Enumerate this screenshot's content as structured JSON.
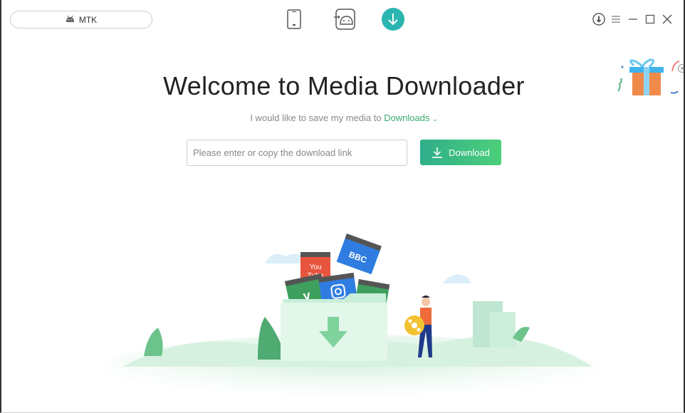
{
  "device": {
    "name": "MTK",
    "icon": "android-icon"
  },
  "nav": [
    {
      "name": "phone-icon"
    },
    {
      "name": "android-transfer-icon"
    },
    {
      "name": "download-icon",
      "active": true
    }
  ],
  "window_controls": [
    "download-circle-icon",
    "menu-icon",
    "minimize-icon",
    "maximize-icon",
    "close-icon"
  ],
  "main": {
    "title": "Welcome to Media Downloader",
    "save_prefix": "I would like to save my media to",
    "save_location": "Downloads",
    "input_placeholder": "Please enter or copy the download link",
    "input_value": "",
    "download_label": "Download"
  },
  "illustration": {
    "labels": [
      "You",
      "Tube",
      "BBC",
      "Vimeo",
      "Instagram"
    ]
  },
  "colors": {
    "accent": "#3aaa6a",
    "nav_active": "#2bb5b0",
    "button_start": "#2fae8a",
    "button_end": "#4ccf7a"
  }
}
